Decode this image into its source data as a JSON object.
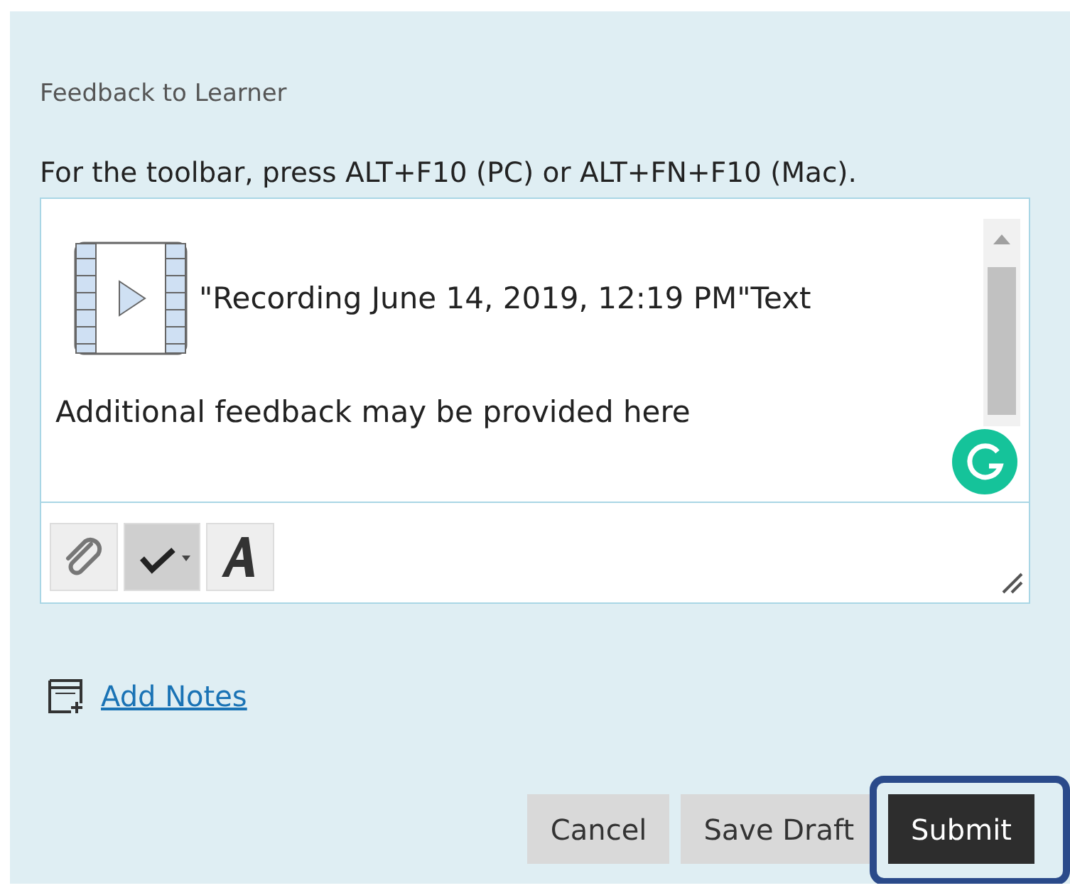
{
  "section_title": "Feedback to Learner",
  "instructions": "For the toolbar, press ALT+F10 (PC) or ALT+FN+F10 (Mac).",
  "editor": {
    "recording_label": "\"Recording June 14, 2019, 12:19 PM\"Text",
    "body": "Additional feedback may be provided here",
    "toolbar": [
      {
        "kind": "attach",
        "pressed": false
      },
      {
        "kind": "spellcheck",
        "pressed": true
      },
      {
        "kind": "font",
        "pressed": false
      }
    ]
  },
  "add_notes": "Add Notes",
  "buttons": [
    {
      "label": "Cancel",
      "kind": "secondary",
      "highlighted": false
    },
    {
      "label": "Save Draft",
      "kind": "secondary",
      "highlighted": false
    },
    {
      "label": "Submit",
      "kind": "primary",
      "highlighted": true
    }
  ]
}
